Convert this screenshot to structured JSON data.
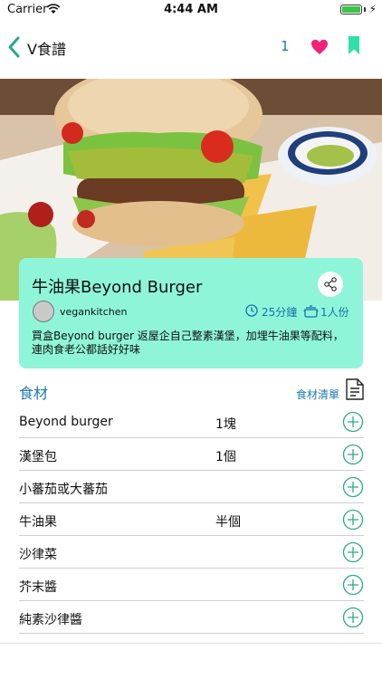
{
  "status": {
    "carrier": "Carrier",
    "time": "4:44 AM"
  },
  "nav": {
    "title": "V食譜",
    "like_count": "1"
  },
  "recipe": {
    "title": "牛油果Beyond Burger",
    "author": "vegankitchen",
    "time": "25分鐘",
    "servings": "1人份",
    "description": "買盒Beyond burger 返屋企自己整素漢堡，加埋牛油果等配料，連肉食老公都話好好味"
  },
  "ingredients": {
    "heading": "食材",
    "shopping_label": "食材清單",
    "items": [
      {
        "name": "Beyond burger",
        "qty": "1塊"
      },
      {
        "name": "漢堡包",
        "qty": "1個"
      },
      {
        "name": "小蕃茄或大蕃茄",
        "qty": ""
      },
      {
        "name": "牛油果",
        "qty": "半個"
      },
      {
        "name": "沙律菜",
        "qty": ""
      },
      {
        "name": "芥末醬",
        "qty": ""
      },
      {
        "name": "純素沙律醬",
        "qty": ""
      }
    ]
  },
  "colors": {
    "accent": "#1e7ab0",
    "card": "#8ff5d9",
    "teal": "#2aa88c",
    "heart": "#f0237a"
  }
}
